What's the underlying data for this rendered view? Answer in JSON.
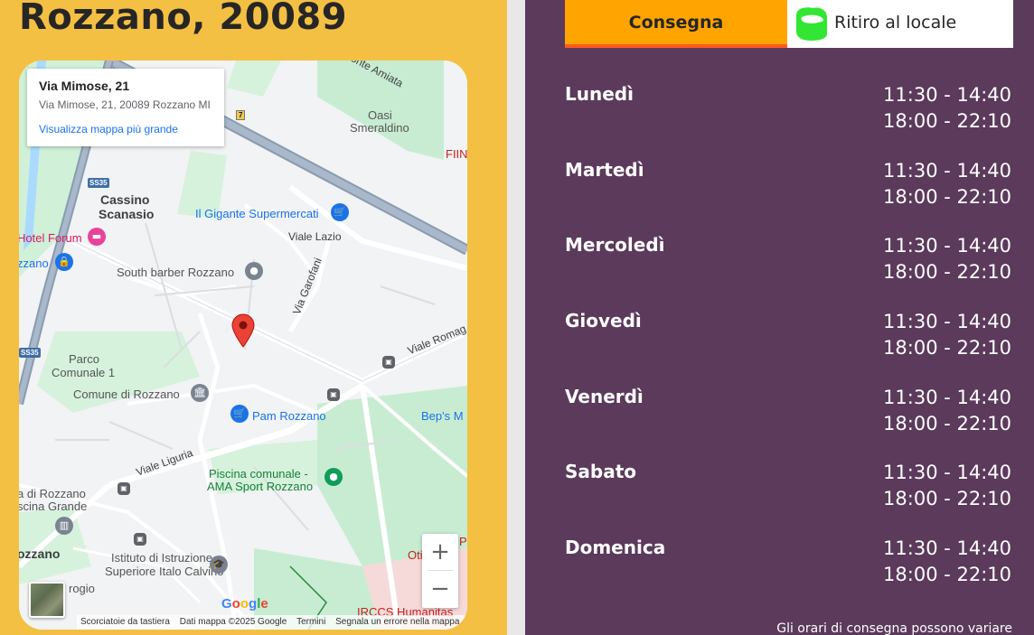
{
  "header": {
    "city": "Rozzano, 20089"
  },
  "map": {
    "infocard": {
      "title": "Via Mimose, 21",
      "address": "Via Mimose, 21, 20089 Rozzano MI",
      "link": "Visualizza mappa più grande"
    },
    "labels": {
      "monte_amiata": "Monte Amiata",
      "oasi": "Oasi",
      "smeraldino": "Smeraldino",
      "fiin": "FIIN",
      "cassino": "Cassino",
      "scanasio": "Scanasio",
      "gigante": "Il Gigante Supermercati",
      "viale_lazio": "Viale Lazio",
      "hotel_forum": "Hotel Forum",
      "zzano": "zzano",
      "south_barber": "South barber Rozzano",
      "via_garofani": "Via Garofani",
      "viale_romagna": "Viale Romag",
      "parco": "Parco",
      "comunale1": "Comunale 1",
      "comune": "Comune di Rozzano",
      "pam": "Pam Rozzano",
      "beps": "Bep's M",
      "viale_liguria": "Viale Liguria",
      "piscina1": "Piscina comunale -",
      "piscina2": "AMA Sport Rozzano",
      "di_rozzano": "a di Rozzano",
      "scina_grande": "scina Grande",
      "ozzano": "ozzano",
      "istituto1": "Istituto di Istruzione",
      "istituto2": "Superiore Italo Calvino",
      "rogio": "rogio",
      "p_right": "P",
      "oti": "Oti",
      "irccs": "IRCCS Humanitas",
      "ss35_a": "SS35",
      "ss35_b": "SS35",
      "route7": "7"
    },
    "zoom_in": "+",
    "zoom_out": "−",
    "google": [
      "G",
      "o",
      "o",
      "g",
      "l",
      "e"
    ],
    "attribution": {
      "shortcuts": "Scorciatoie da tastiera",
      "data": "Dati mappa ©2025 Google",
      "terms": "Termini",
      "report": "Segnala un errore nella mappa"
    }
  },
  "tabs": {
    "delivery": "Consegna",
    "pickup": "Ritiro al locale"
  },
  "schedule": [
    {
      "day": "Lunedì",
      "hours": [
        "11:30 - 14:40",
        "18:00 - 22:10"
      ]
    },
    {
      "day": "Martedì",
      "hours": [
        "11:30 - 14:40",
        "18:00 - 22:10"
      ]
    },
    {
      "day": "Mercoledì",
      "hours": [
        "11:30 - 14:40",
        "18:00 - 22:10"
      ]
    },
    {
      "day": "Giovedì",
      "hours": [
        "11:30 - 14:40",
        "18:00 - 22:10"
      ]
    },
    {
      "day": "Venerdì",
      "hours": [
        "11:30 - 14:40",
        "18:00 - 22:10"
      ]
    },
    {
      "day": "Sabato",
      "hours": [
        "11:30 - 14:40",
        "18:00 - 22:10"
      ]
    },
    {
      "day": "Domenica",
      "hours": [
        "11:30 - 14:40",
        "18:00 - 22:10"
      ]
    }
  ],
  "note": "Gli orari di consegna possono variare",
  "colors": {
    "left_bg": "#f4c043",
    "right_bg": "#5b3a5b",
    "tab_active": "#ffa400",
    "tab_underline": "#ff5a1a",
    "pickup_icon": "#33e633"
  },
  "icons": {
    "pin": "map-pin-icon",
    "pickup": "pickup-bag-icon",
    "cart": "shopping-cart-icon"
  }
}
